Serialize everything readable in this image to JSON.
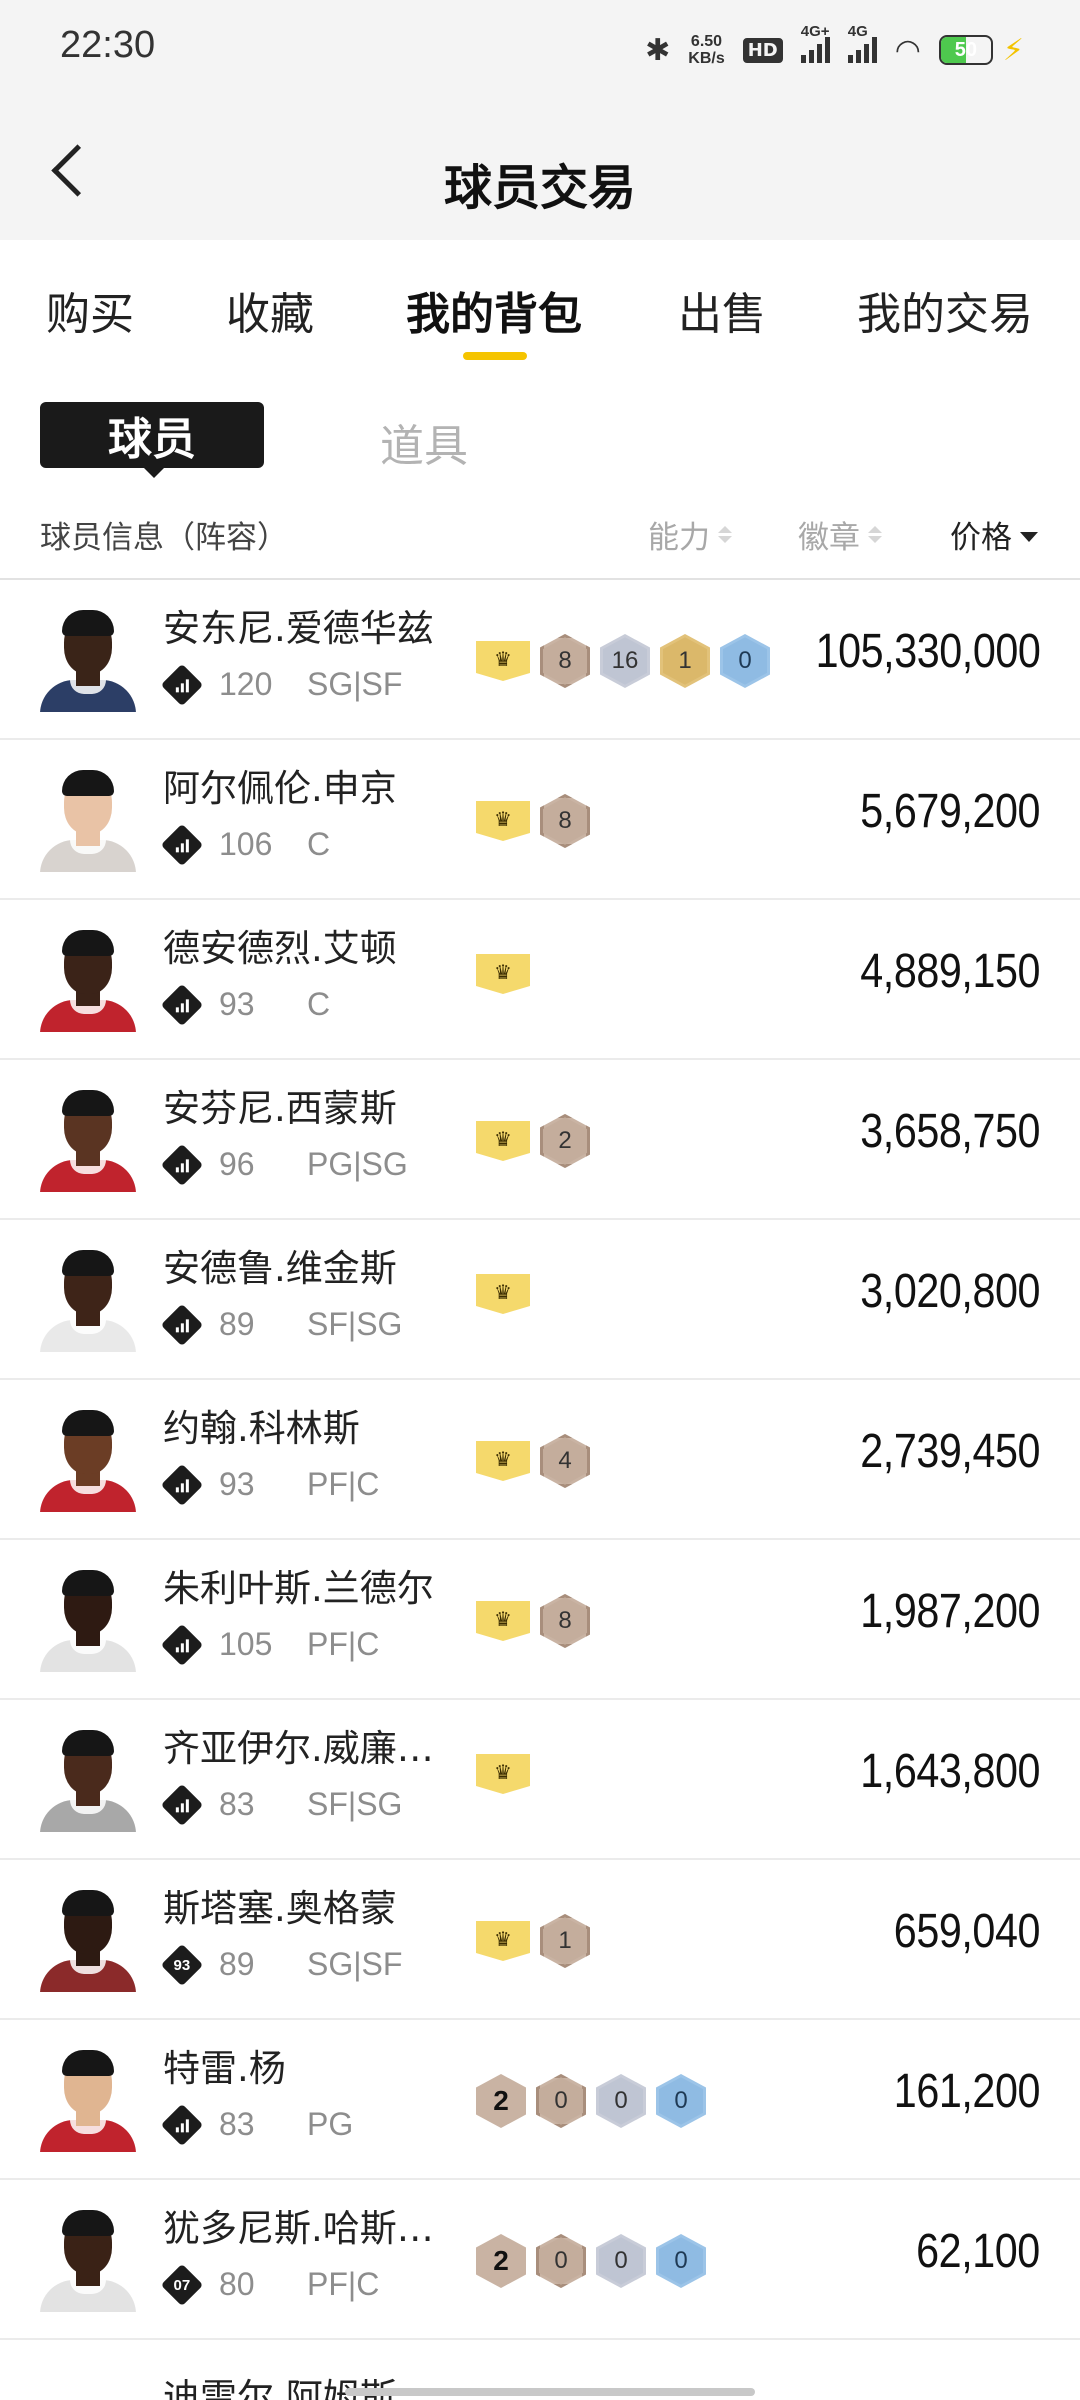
{
  "status_bar": {
    "time": "22:30",
    "net_speed_value": "6.50",
    "net_speed_unit": "KB/s",
    "hd_label": "HD",
    "signal1_label": "4G+",
    "signal2_label": "4G",
    "battery": "50"
  },
  "header": {
    "title": "球员交易"
  },
  "tabs": [
    {
      "label": "购买",
      "active": false
    },
    {
      "label": "收藏",
      "active": false
    },
    {
      "label": "我的背包",
      "active": true
    },
    {
      "label": "出售",
      "active": false
    },
    {
      "label": "我的交易",
      "active": false
    }
  ],
  "subtabs": [
    {
      "label": "球员",
      "active": true
    },
    {
      "label": "道具",
      "active": false
    }
  ],
  "columns": {
    "info": "球员信息（阵容）",
    "ability": "能力",
    "badges": "徽章",
    "price": "价格"
  },
  "players": [
    {
      "name": "安东尼.爱德华兹",
      "rating": "120",
      "positions": "SG|SF",
      "rating_icon": "bars",
      "crown": true,
      "rank": null,
      "badges": [
        "8",
        "16",
        "1",
        "0"
      ],
      "price": "105,330,000",
      "skin": "#3a2418",
      "jersey": "#2c3e66"
    },
    {
      "name": "阿尔佩伦.申京",
      "rating": "106",
      "positions": "C",
      "rating_icon": "bars",
      "crown": true,
      "rank": null,
      "badges": [
        "8"
      ],
      "price": "5,679,200",
      "skin": "#e9c3a6",
      "jersey": "#d8d3cf"
    },
    {
      "name": "德安德烈.艾顿",
      "rating": "93",
      "positions": "C",
      "rating_icon": "bars",
      "crown": true,
      "rank": null,
      "badges": [],
      "price": "4,889,150",
      "skin": "#3b2318",
      "jersey": "#c0232d"
    },
    {
      "name": "安芬尼.西蒙斯",
      "rating": "96",
      "positions": "PG|SG",
      "rating_icon": "bars",
      "crown": true,
      "rank": null,
      "badges": [
        "2"
      ],
      "price": "3,658,750",
      "skin": "#5a3422",
      "jersey": "#c0232d"
    },
    {
      "name": "安德鲁.维金斯",
      "rating": "89",
      "positions": "SF|SG",
      "rating_icon": "bars",
      "crown": true,
      "rank": null,
      "badges": [],
      "price": "3,020,800",
      "skin": "#3e2418",
      "jersey": "#e9e9e9"
    },
    {
      "name": "约翰.科林斯",
      "rating": "93",
      "positions": "PF|C",
      "rating_icon": "bars",
      "crown": true,
      "rank": null,
      "badges": [
        "4"
      ],
      "price": "2,739,450",
      "skin": "#6b3d25",
      "jersey": "#c0232d"
    },
    {
      "name": "朱利叶斯.兰德尔",
      "rating": "105",
      "positions": "PF|C",
      "rating_icon": "bars",
      "crown": true,
      "rank": null,
      "badges": [
        "8"
      ],
      "price": "1,987,200",
      "skin": "#2e1a12",
      "jersey": "#e3e3e3"
    },
    {
      "name": "齐亚伊尔.威廉…",
      "rating": "83",
      "positions": "SF|SG",
      "rating_icon": "bars",
      "crown": true,
      "rank": null,
      "badges": [],
      "price": "1,643,800",
      "skin": "#4a2a1c",
      "jersey": "#a8a8a8"
    },
    {
      "name": "斯塔塞.奥格蒙",
      "rating": "89",
      "positions": "SG|SF",
      "rating_icon": "93",
      "crown": true,
      "rank": null,
      "badges": [
        "1"
      ],
      "price": "659,040",
      "skin": "#2d1a12",
      "jersey": "#8b2a2a"
    },
    {
      "name": "特雷.杨",
      "rating": "83",
      "positions": "PG",
      "rating_icon": "bars",
      "crown": false,
      "rank": "2",
      "badges": [
        "0",
        "0",
        "0"
      ],
      "price": "161,200",
      "skin": "#e0b591",
      "jersey": "#c0232d"
    },
    {
      "name": "犹多尼斯.哈斯…",
      "rating": "80",
      "positions": "PF|C",
      "rating_icon": "07",
      "crown": false,
      "rank": "2",
      "badges": [
        "0",
        "0",
        "0"
      ],
      "price": "62,100",
      "skin": "#3a2216",
      "jersey": "#e3e3e3"
    }
  ],
  "partial_next": "迪雷尔.阿姆斯",
  "colors": {
    "accent": "#f5c400",
    "crown": "#f5d96c",
    "price_text": "#111111"
  }
}
